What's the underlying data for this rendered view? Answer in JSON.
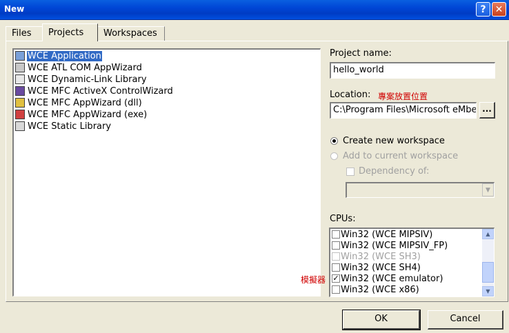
{
  "window": {
    "title": "New"
  },
  "tabs": [
    {
      "label": "Files"
    },
    {
      "label": "Projects"
    },
    {
      "label": "Workspaces"
    }
  ],
  "project_types": [
    {
      "label": "WCE Application",
      "selected": true,
      "icon": "app-icon"
    },
    {
      "label": "WCE ATL COM AppWizard",
      "icon": "atl-icon"
    },
    {
      "label": "WCE Dynamic-Link Library",
      "icon": "dll-icon"
    },
    {
      "label": "WCE MFC ActiveX ControlWizard",
      "icon": "activex-icon"
    },
    {
      "label": "WCE MFC AppWizard (dll)",
      "icon": "mfc-dll-icon"
    },
    {
      "label": "WCE MFC AppWizard (exe)",
      "icon": "mfc-exe-icon"
    },
    {
      "label": "WCE Static Library",
      "icon": "lib-icon"
    }
  ],
  "form": {
    "project_name_label": "Project name:",
    "project_name_value": "hello_world",
    "location_label": "Location:",
    "location_note": "專案放置位置",
    "location_value": "C:\\Program Files\\Microsoft eMbe",
    "browse_label": "...",
    "create_new_label": "Create new workspace",
    "add_current_label": "Add to current workspace",
    "dependency_label": "Dependency of:",
    "cpus_label": "CPUs:",
    "emulator_note": "模擬器"
  },
  "cpus": [
    {
      "label": "Win32 (WCE MIPSIV)",
      "checked": false,
      "disabled": false
    },
    {
      "label": "Win32 (WCE MIPSIV_FP)",
      "checked": false,
      "disabled": false
    },
    {
      "label": "Win32 (WCE SH3)",
      "checked": false,
      "disabled": true
    },
    {
      "label": "Win32 (WCE SH4)",
      "checked": false,
      "disabled": false
    },
    {
      "label": "Win32 (WCE emulator)",
      "checked": true,
      "disabled": false
    },
    {
      "label": "Win32 (WCE x86)",
      "checked": false,
      "disabled": false
    }
  ],
  "buttons": {
    "ok": "OK",
    "cancel": "Cancel",
    "help": "?",
    "close": "✕"
  },
  "colors": {
    "title_bar": "#0046d6",
    "selection": "#316ac5",
    "annotation": "#d00000",
    "dialog": "#ece9d8"
  }
}
